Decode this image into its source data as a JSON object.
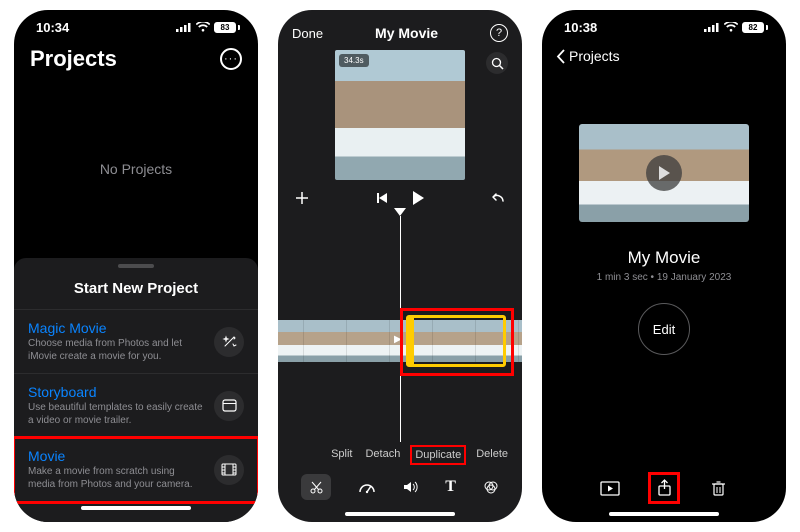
{
  "colors": {
    "accent": "#0a84ff",
    "highlight": "#ff0000",
    "selection": "#ffcc00"
  },
  "phone1": {
    "status_time": "10:34",
    "battery": "83",
    "header_title": "Projects",
    "empty_text": "No Projects",
    "sheet_title": "Start New Project",
    "options": [
      {
        "title": "Magic Movie",
        "desc": "Choose media from Photos and let iMovie create a movie for you.",
        "icon": "wand-icon"
      },
      {
        "title": "Storyboard",
        "desc": "Use beautiful templates to easily create a video or movie trailer.",
        "icon": "storyboard-icon"
      },
      {
        "title": "Movie",
        "desc": "Make a movie from scratch using media from Photos and your camera.",
        "icon": "film-icon"
      }
    ]
  },
  "phone2": {
    "done_label": "Done",
    "title": "My Movie",
    "duration_badge": "34.3s",
    "clip_actions": [
      "Split",
      "Detach",
      "Duplicate",
      "Delete"
    ],
    "highlighted_action_index": 2
  },
  "phone3": {
    "status_time": "10:38",
    "battery": "82",
    "back_label": "Projects",
    "movie_title": "My Movie",
    "movie_meta": "1 min 3 sec • 19 January 2023",
    "edit_label": "Edit"
  }
}
